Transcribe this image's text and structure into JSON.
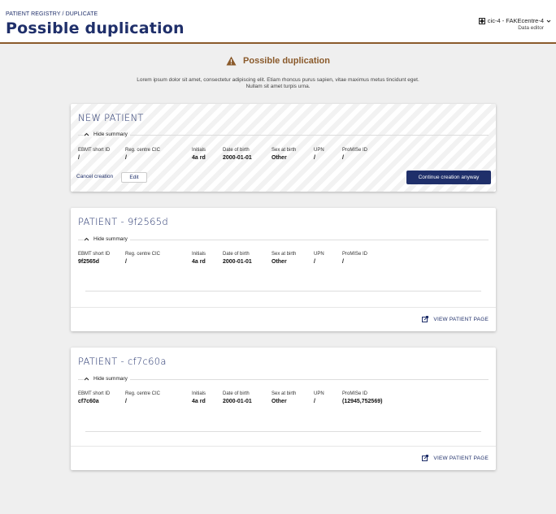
{
  "header": {
    "breadcrumb": [
      "PATIENT REGISTRY",
      "DUPLICATE"
    ],
    "breadcrumb_sep": "/",
    "title": "Possible duplication",
    "user": {
      "centre": "cic-4 - FAKEcentre-4",
      "role": "Data editor"
    }
  },
  "warning": {
    "title": "Possible duplication",
    "text": "Lorem ipsum dolor sit amet, consectetur adipiscing elit. Etiam rhoncus purus sapien, vitae maximus metus tincidunt eget. Nullam sit amet turpis urna."
  },
  "field_labels": {
    "ebmt": "EBMT short ID",
    "regcic": "Reg. centre CIC",
    "initials": "Initials",
    "dob": "Date of birth",
    "sex": "Sex at birth",
    "upn": "UPN",
    "promise": "ProMISe ID"
  },
  "summary_toggle": "Hide summary",
  "new_patient": {
    "title": "NEW PATIENT",
    "values": {
      "ebmt": "/",
      "regcic": "/",
      "initials": "4a rd",
      "dob": "2000-01-01",
      "sex": "Other",
      "upn": "/",
      "promise": "/"
    },
    "cancel_label": "Cancel creation",
    "edit_label": "Edit",
    "continue_label": "Continue creation anyway"
  },
  "patients": [
    {
      "title": "PATIENT - 9f2565d",
      "values": {
        "ebmt": "9f2565d",
        "regcic": "/",
        "initials": "4a rd",
        "dob": "2000-01-01",
        "sex": "Other",
        "upn": "/",
        "promise": "/"
      },
      "link": "VIEW PATIENT PAGE"
    },
    {
      "title": "PATIENT - cf7c60a",
      "values": {
        "ebmt": "cf7c60a",
        "regcic": "/",
        "initials": "4a rd",
        "dob": "2000-01-01",
        "sex": "Other",
        "upn": "/",
        "promise": "(12945,752569)"
      },
      "link": "VIEW PATIENT PAGE"
    }
  ]
}
